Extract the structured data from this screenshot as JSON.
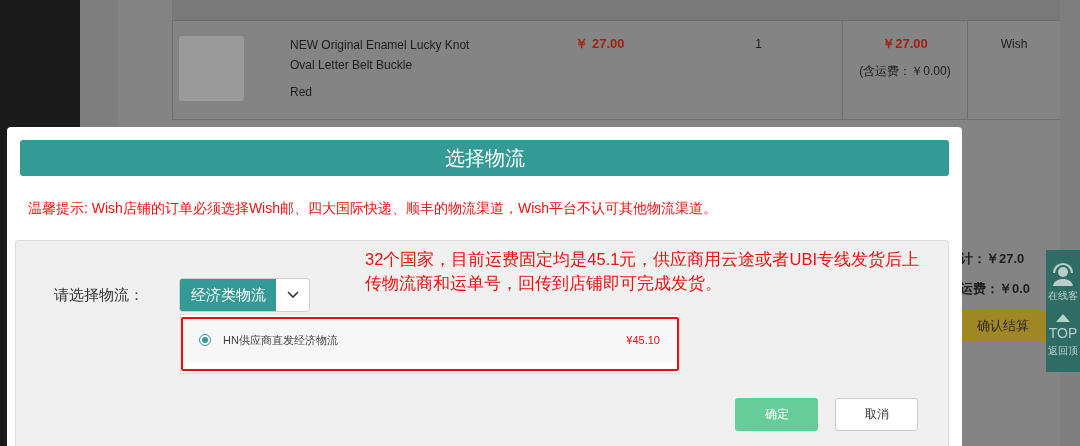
{
  "order_row": {
    "product_title": "NEW Original Enamel Lucky Knot Oval Letter Belt Buckle",
    "variant": "Red",
    "unit_price": "￥ 27.00",
    "quantity": "1",
    "subtotal": "￥27.00",
    "shipping_note": "(含运费：￥0.00)",
    "platform": "Wish"
  },
  "summary": {
    "total": "计：￥27.0",
    "shipping": "运费：￥0.0",
    "checkout_button": "确认结算"
  },
  "side_widget": {
    "service": "在线客",
    "top": "TOP",
    "back": "返回顶"
  },
  "dialog": {
    "title": "选择物流",
    "notice": "温馨提示: Wish店铺的订单必须选择Wish邮、四大国际快递、顺丰的物流渠道，Wish平台不认可其他物流渠道。",
    "field_label": "请选择物流：",
    "dropdown_value": "经济类物流",
    "annotation": "32个国家，目前运费固定均是45.1元，供应商用云途或者UBI专线发货后上传物流商和运单号，回传到店铺即可完成发货。",
    "options": [
      {
        "name": "HN供应商直发经济物流",
        "price": "¥45.10",
        "selected": true
      }
    ],
    "buttons": [
      {
        "label": "确定",
        "kind": "primary"
      },
      {
        "label": "取消",
        "kind": "secondary"
      }
    ]
  }
}
